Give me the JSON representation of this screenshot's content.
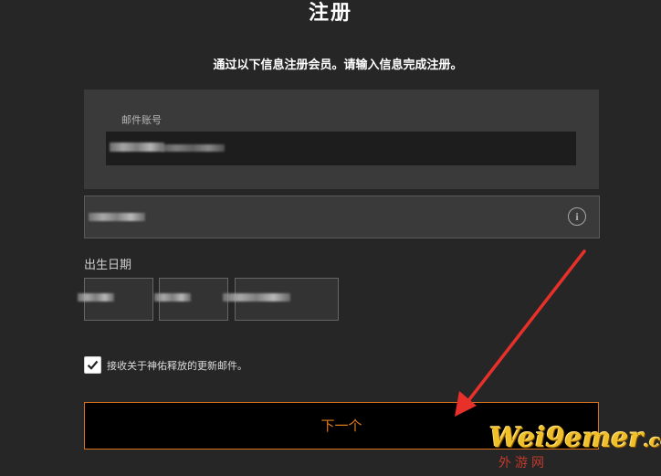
{
  "header": {
    "title": "注册",
    "subtitle": "通过以下信息注册会员。请输入信息完成注册。"
  },
  "form": {
    "email_label": "邮件账号",
    "email_value": "",
    "password_value": "",
    "info_icon": "info-icon",
    "dob_label": "出生日期",
    "dob_year": "",
    "dob_month": "",
    "dob_day": "",
    "newsletter_label": "接收关于神佑释放的更新邮件。",
    "newsletter_checked": true,
    "next_button": "下一个"
  },
  "watermark": {
    "brand": "Wei9emer",
    "suffix": ".com",
    "chinese": "外游网"
  },
  "colors": {
    "background": "#262626",
    "accent": "#e07a1f",
    "annotation_arrow": "#e8302a"
  }
}
